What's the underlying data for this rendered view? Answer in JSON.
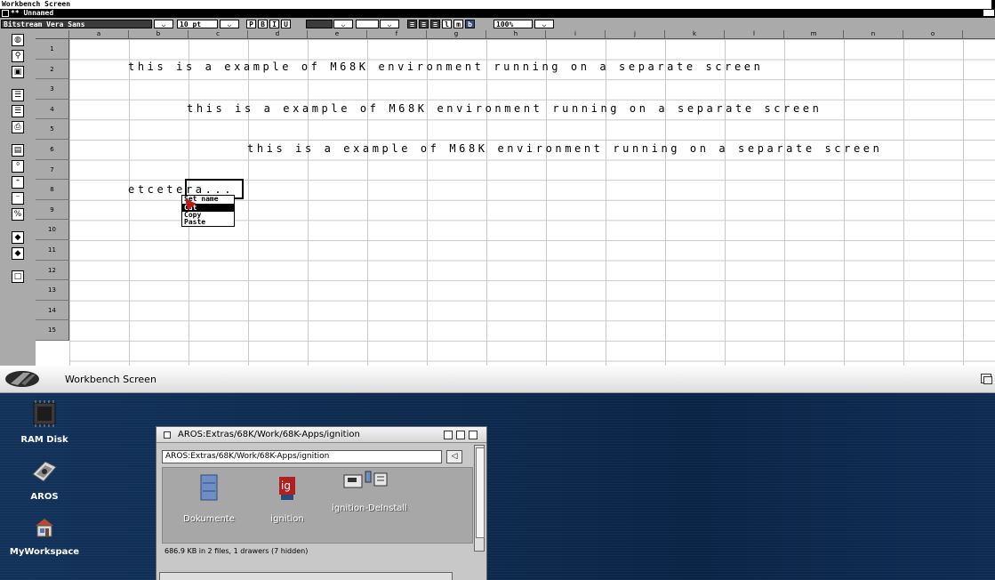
{
  "screen68k": {
    "screen_title": "Workbench Screen",
    "window_title": "Unnamed",
    "window_marker": "**",
    "toolbar": {
      "font_name": "Bitstream Vera Sans",
      "font_size": "10 pt",
      "style_buttons": [
        "P",
        "B",
        "I",
        "U"
      ],
      "align_buttons": [
        "l",
        "m",
        "b"
      ],
      "zoom": "100%"
    },
    "columns": [
      "a",
      "b",
      "c",
      "d",
      "e",
      "f",
      "g",
      "h",
      "i",
      "j",
      "k",
      "l",
      "m",
      "n",
      "o"
    ],
    "rows": [
      "1",
      "2",
      "3",
      "4",
      "5",
      "6",
      "7",
      "8",
      "9",
      "10",
      "11",
      "12",
      "13",
      "14",
      "15"
    ],
    "cells": {
      "b1": "this is a example of M68K environment running on a separate screen",
      "c3": "this is a example of M68K environment running on a separate screen",
      "d5": "this is a example of M68K environment running on a separate screen",
      "b7": "etcetera..."
    },
    "context_menu": {
      "title": "Set name",
      "items": [
        "Cut",
        "Copy",
        "Paste"
      ],
      "highlighted": "Cut"
    }
  },
  "workbench": {
    "title": "Workbench Screen",
    "desktop_icons": [
      {
        "label": "RAM Disk",
        "icon": "chip-icon"
      },
      {
        "label": "AROS",
        "icon": "disk-drive-icon"
      },
      {
        "label": "MyWorkspace",
        "icon": "workspace-icon"
      }
    ],
    "drawer": {
      "title": "AROS:Extras/68K/Work/68K-Apps/ignition",
      "path": "AROS:Extras/68K/Work/68K-Apps/ignition",
      "files": [
        {
          "label": "Dokumente",
          "icon": "drawer-icon"
        },
        {
          "label": "ignition",
          "icon": "ignition-app-icon"
        },
        {
          "label": "ignition-DeInstall",
          "icon": "deinstall-icon"
        }
      ],
      "status": "686.9 KB in 2 files, 1 drawers (7 hidden)"
    }
  }
}
